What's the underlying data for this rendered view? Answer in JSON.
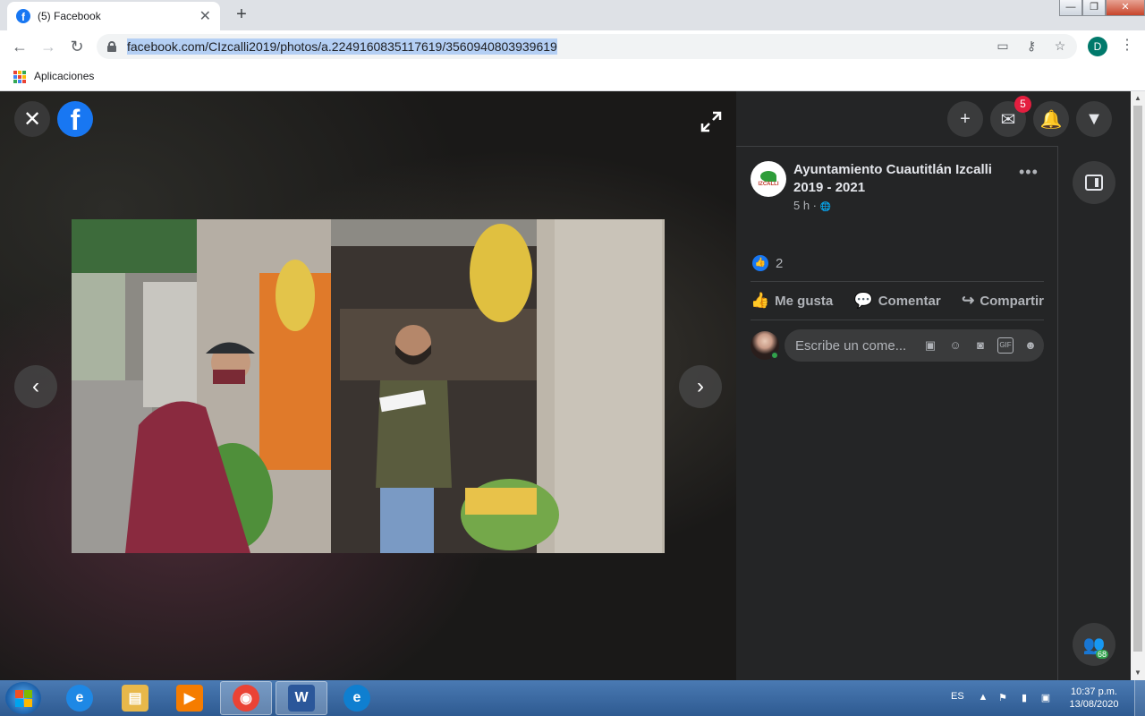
{
  "browser": {
    "tab_title": "(5) Facebook",
    "tab_close": "✕",
    "new_tab": "+",
    "window_controls": {
      "minimize": "—",
      "restore": "❐",
      "close": "✕"
    },
    "url": "facebook.com/CIzcalli2019/photos/a.2249160835117619/3560940803939619",
    "profile_initial": "D",
    "bookmarks_apps_label": "Aplicaciones",
    "apps_colors": [
      "#ea4335",
      "#fbbc05",
      "#34a853",
      "#4285f4",
      "#ea4335",
      "#fbbc05",
      "#34a853",
      "#4285f4",
      "#ea4335"
    ]
  },
  "viewer": {
    "close_glyph": "✕",
    "logo_glyph": "f",
    "prev_glyph": "‹",
    "next_glyph": "›"
  },
  "panel": {
    "top_icons": [
      {
        "name": "create-icon",
        "glyph": "+"
      },
      {
        "name": "messenger-icon",
        "glyph": "✉",
        "badge": "5"
      },
      {
        "name": "notifications-icon",
        "glyph": "🔔"
      },
      {
        "name": "account-menu-icon",
        "glyph": "▼"
      }
    ],
    "post": {
      "page_name": "Ayuntamiento Cuautitlán Izcalli 2019 - 2021",
      "avatar_text": "IZCALLI",
      "time": "5 h ·",
      "privacy_glyph": "🌐",
      "more_glyph": "•••",
      "like_glyph": "👍",
      "like_count": "2",
      "actions": [
        {
          "name": "like",
          "label": "Me gusta",
          "glyph": "👍"
        },
        {
          "name": "comment",
          "label": "Comentar",
          "glyph": "💬"
        },
        {
          "name": "share",
          "label": "Compartir",
          "glyph": "↪"
        }
      ],
      "comment_placeholder": "Escribe un come...",
      "comment_icons": [
        "sticker-icon",
        "emoji-icon",
        "camera-icon",
        "gif-icon",
        "avatar-sticker-icon"
      ],
      "comment_icon_glyphs": [
        "▣",
        "☺",
        "◙",
        "GIF",
        "☻"
      ]
    },
    "contacts_count": "68"
  },
  "taskbar": {
    "lang": "ES",
    "time": "10:37 p.m.",
    "date": "13/08/2020",
    "apps": [
      {
        "name": "internet-explorer",
        "glyph": "e",
        "color": "#1e88e5"
      },
      {
        "name": "file-explorer",
        "glyph": "▤",
        "color": "#e8b84a"
      },
      {
        "name": "media-player",
        "glyph": "▶",
        "color": "#f57c00"
      },
      {
        "name": "chrome",
        "glyph": "◉",
        "color": "#ea4335"
      },
      {
        "name": "word",
        "glyph": "W",
        "color": "#2b579a"
      },
      {
        "name": "edge",
        "glyph": "e",
        "color": "#0f7fd0"
      }
    ]
  }
}
